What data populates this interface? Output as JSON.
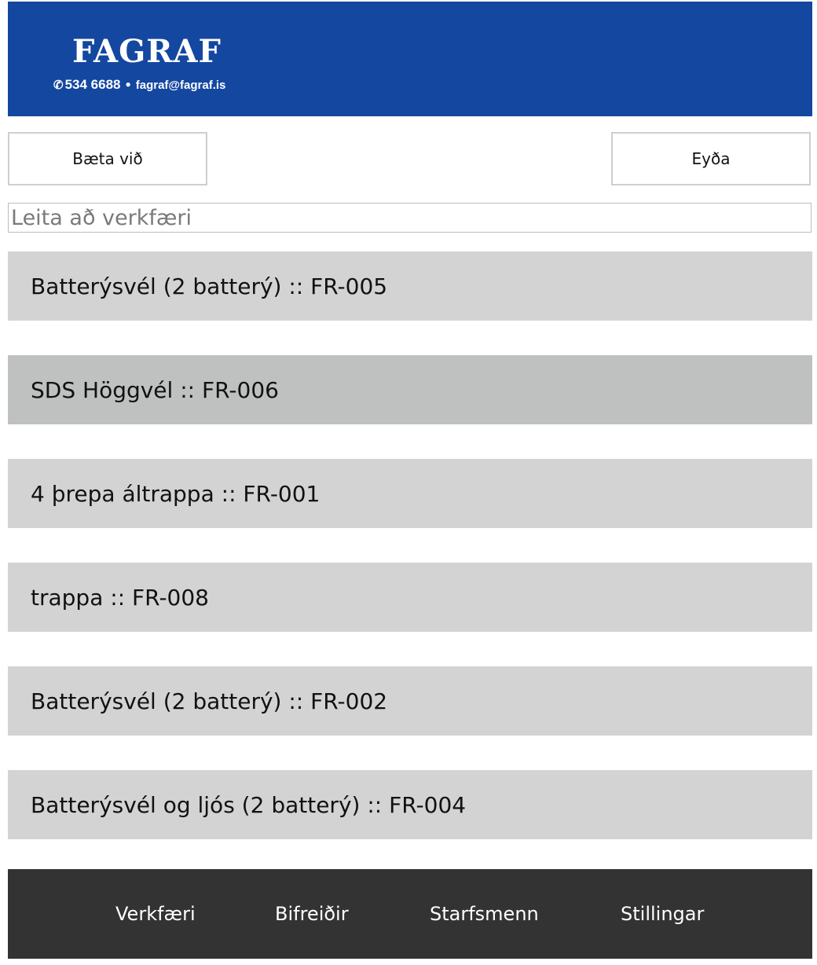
{
  "header": {
    "logo_text": "FAGRAF",
    "phone": "534 6688",
    "email": "fagraf@fagraf.is",
    "phone_icon": "phone-icon",
    "background": "#1447a0"
  },
  "actions": {
    "add_label": "Bæta við",
    "delete_label": "Eyða"
  },
  "search": {
    "placeholder": "Leita að verkfæri",
    "value": ""
  },
  "tools": [
    {
      "label": "Batterýsvél (2 batterý) :: FR-005"
    },
    {
      "label": "SDS Höggvél :: FR-006"
    },
    {
      "label": "4 þrepa áltrappa :: FR-001"
    },
    {
      "label": "trappa :: FR-008"
    },
    {
      "label": "Batterýsvél (2 batterý) :: FR-002"
    },
    {
      "label": "Batterýsvél og ljós (2 batterý) :: FR-004"
    }
  ],
  "nav": {
    "items": [
      {
        "label": "Verkfæri"
      },
      {
        "label": "Bifreiðir"
      },
      {
        "label": "Starfsmenn"
      },
      {
        "label": "Stillingar"
      }
    ]
  },
  "colors": {
    "item_bg": "#d3d3d3",
    "item_bg_hover": "#bfc1c0",
    "footer_bg": "#333333"
  }
}
